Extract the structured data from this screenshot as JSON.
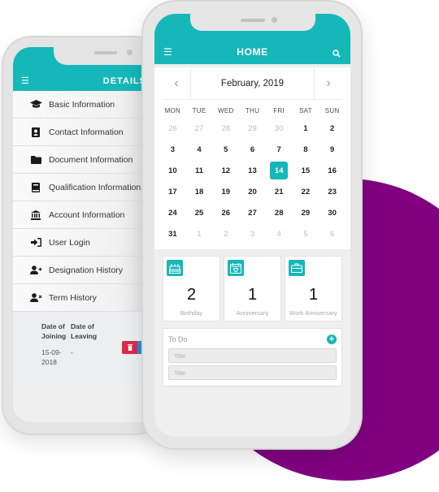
{
  "colors": {
    "accent": "#16b7b9",
    "blob": "#800080",
    "danger": "#dc2b4d",
    "info": "#1f8ee0"
  },
  "details_phone": {
    "title": "DETAILS",
    "menu_icon": "hamburger-icon",
    "items": [
      {
        "label": "Basic Information",
        "icon": "graduation-cap-icon"
      },
      {
        "label": "Contact Information",
        "icon": "contact-card-icon"
      },
      {
        "label": "Document Information",
        "icon": "folder-icon"
      },
      {
        "label": "Qualification Information",
        "icon": "book-icon"
      },
      {
        "label": "Account Information",
        "icon": "bank-icon"
      },
      {
        "label": "User Login",
        "icon": "sign-in-icon"
      },
      {
        "label": "Designation History",
        "icon": "user-plus-icon"
      },
      {
        "label": "Term History",
        "icon": "user-times-icon"
      }
    ],
    "table": {
      "headers": [
        "Date of Joining",
        "Date of Leaving"
      ],
      "header_lines": [
        [
          "Date of",
          "Joining"
        ],
        [
          "Date of",
          "Leaving"
        ]
      ],
      "rows": [
        {
          "joining": [
            "15-09-",
            "2018"
          ],
          "leaving": "-"
        }
      ]
    }
  },
  "home_phone": {
    "title": "HOME",
    "calendar": {
      "month_label": "February, 2019",
      "weekdays": [
        "MON",
        "TUE",
        "WED",
        "THU",
        "FRI",
        "SAT",
        "SUN"
      ],
      "days": [
        {
          "d": "26",
          "m": true
        },
        {
          "d": "27",
          "m": true
        },
        {
          "d": "28",
          "m": true
        },
        {
          "d": "29",
          "m": true
        },
        {
          "d": "30",
          "m": true
        },
        {
          "d": "1"
        },
        {
          "d": "2"
        },
        {
          "d": "3"
        },
        {
          "d": "4"
        },
        {
          "d": "5"
        },
        {
          "d": "6"
        },
        {
          "d": "7"
        },
        {
          "d": "8"
        },
        {
          "d": "9"
        },
        {
          "d": "10"
        },
        {
          "d": "11"
        },
        {
          "d": "12"
        },
        {
          "d": "13"
        },
        {
          "d": "14",
          "sel": true
        },
        {
          "d": "15"
        },
        {
          "d": "16"
        },
        {
          "d": "17"
        },
        {
          "d": "18"
        },
        {
          "d": "19"
        },
        {
          "d": "20"
        },
        {
          "d": "21"
        },
        {
          "d": "22"
        },
        {
          "d": "23"
        },
        {
          "d": "24"
        },
        {
          "d": "25"
        },
        {
          "d": "26"
        },
        {
          "d": "27"
        },
        {
          "d": "28"
        },
        {
          "d": "29"
        },
        {
          "d": "30"
        },
        {
          "d": "31"
        },
        {
          "d": "1",
          "m": true
        },
        {
          "d": "2",
          "m": true
        },
        {
          "d": "3",
          "m": true
        },
        {
          "d": "4",
          "m": true
        },
        {
          "d": "5",
          "m": true
        },
        {
          "d": "6",
          "m": true
        }
      ],
      "selected_day": "14"
    },
    "stats": [
      {
        "count": "2",
        "label": "Birthday",
        "icon": "birthday-cake-icon"
      },
      {
        "count": "1",
        "label": "Anniversary",
        "icon": "calendar-heart-icon"
      },
      {
        "count": "1",
        "label": "Work Anniversary",
        "icon": "briefcase-icon"
      }
    ],
    "todo": {
      "title": "To Do",
      "inputs": [
        {
          "placeholder": "Title",
          "value": ""
        },
        {
          "placeholder": "Title",
          "value": ""
        }
      ]
    }
  }
}
